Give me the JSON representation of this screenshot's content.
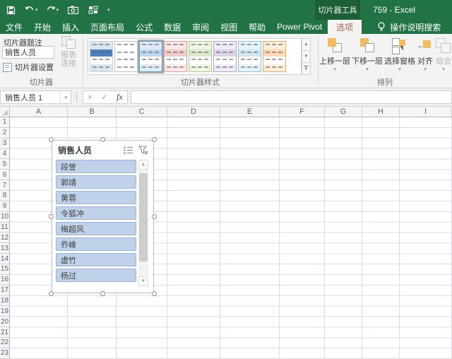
{
  "title_bar": {
    "contextual_tool": "切片器工具",
    "window_title": "759 - Excel"
  },
  "qat": {
    "icons": [
      "save-icon",
      "undo-icon",
      "redo-icon",
      "camera-icon",
      "switch-windows-icon",
      "customize-qat-caret"
    ]
  },
  "tabs": [
    "文件",
    "开始",
    "插入",
    "页面布局",
    "公式",
    "数据",
    "审阅",
    "视图",
    "帮助",
    "Power Pivot"
  ],
  "contextual": {
    "options_tab": "选项"
  },
  "search": {
    "label": "操作说明搜索"
  },
  "ribbon": {
    "slicer_group": {
      "caption_label": "切片器题注",
      "caption_value": "销售人员",
      "settings_label": "切片器设置",
      "report_line1": "报表",
      "report_line2": "连接",
      "group_name": "切片器"
    },
    "styles_group": {
      "group_name": "切片器样式",
      "styles": [
        {
          "name": "light-blue-strong",
          "border": "#c9d4e2",
          "band": "#4f81bd",
          "light": "#dce6f1",
          "cls": ""
        },
        {
          "name": "plain",
          "border": "#c3c3c3",
          "band": "#ffffff",
          "light": "#ffffff",
          "cls": ""
        },
        {
          "name": "light-blue-selected",
          "border": "#5b9bd5",
          "band": "#bdd7ee",
          "light": "#deebf7",
          "cls": "selected"
        },
        {
          "name": "light-red",
          "border": "#e39c9c",
          "band": "#f2caca",
          "light": "#fbe8e8",
          "cls": ""
        },
        {
          "name": "light-green",
          "border": "#a8c98a",
          "band": "#d8e8c8",
          "light": "#eef5e6",
          "cls": ""
        },
        {
          "name": "light-purple",
          "border": "#b3a2c9",
          "band": "#dcd4e8",
          "light": "#f0ecf6",
          "cls": ""
        },
        {
          "name": "light-teal",
          "border": "#8fc0dc",
          "band": "#cfe5f0",
          "light": "#e8f3f8",
          "cls": ""
        },
        {
          "name": "light-orange",
          "border": "#edab67",
          "band": "#fbd9b5",
          "light": "#fdeedd",
          "cls": ""
        }
      ]
    },
    "arrange_group": {
      "group_name": "排列",
      "buttons": [
        {
          "label": "上移一层",
          "caret": "▾",
          "icon": "ic-forward",
          "state": ""
        },
        {
          "label": "下移一层",
          "caret": "▾",
          "icon": "ic-backward",
          "state": ""
        },
        {
          "label": "选择窗格",
          "caret": "▾",
          "icon": "ic-selpane",
          "state": ""
        },
        {
          "label": "对齐",
          "caret": "▾",
          "icon": "ic-align",
          "state": ""
        },
        {
          "label": "组合",
          "caret": "▾",
          "icon": "ic-group",
          "state": "disabled"
        }
      ]
    }
  },
  "formula_bar": {
    "name_box": "销售人员 1",
    "cancel": "×",
    "enter": "✓",
    "fx": "fx",
    "value": ""
  },
  "grid": {
    "columns": [
      {
        "letter": "A",
        "width": 82
      },
      {
        "letter": "B",
        "width": 69
      },
      {
        "letter": "C",
        "width": 72
      },
      {
        "letter": "D",
        "width": 75
      },
      {
        "letter": "E",
        "width": 84
      },
      {
        "letter": "F",
        "width": 64
      },
      {
        "letter": "G",
        "width": 53
      },
      {
        "letter": "H",
        "width": 53
      },
      {
        "letter": "I",
        "width": 74
      }
    ],
    "rows": [
      "1",
      "2",
      "3",
      "4",
      "5",
      "6",
      "7",
      "8",
      "9",
      "10",
      "11",
      "12",
      "13",
      "14",
      "15",
      "16",
      "17",
      "18",
      "19",
      "20",
      "21",
      "22",
      "23"
    ]
  },
  "slicer": {
    "title": "销售人员",
    "items": [
      "段誉",
      "郭靖",
      "黄蓉",
      "令狐冲",
      "梅超风",
      "乔峰",
      "虚竹",
      "杨过"
    ],
    "icons": [
      "multi-select-icon",
      "clear-filter-icon"
    ]
  }
}
